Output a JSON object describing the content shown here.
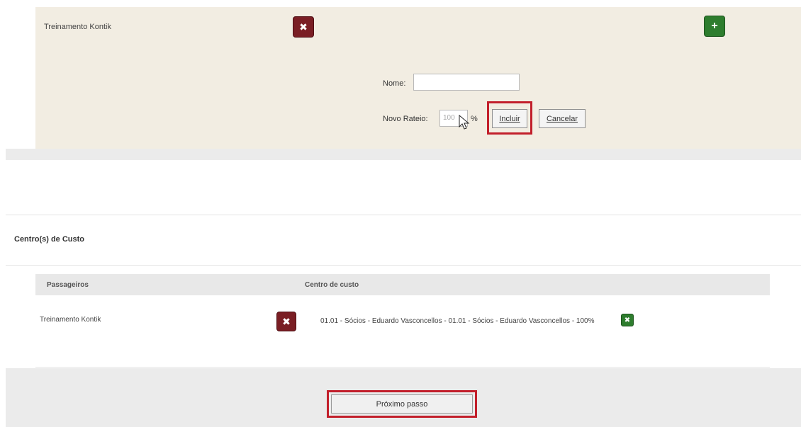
{
  "edit_panel": {
    "passenger_name": "Treinamento Kontik",
    "remove_icon": "close-icon",
    "add_icon": "plus-icon",
    "nome_label": "Nome:",
    "nome_value": "",
    "rateio_label": "Novo Rateio:",
    "rateio_value": "100",
    "percent_sign": "%",
    "incluir_label": "Incluir",
    "cancelar_label": "Cancelar"
  },
  "cost_center_section": {
    "title": "Centro(s) de Custo",
    "columns": [
      "Passageiros",
      "Centro de custo"
    ],
    "rows": [
      {
        "passenger": "Treinamento Kontik",
        "cost_center": "01.01 - Sócios - Eduardo Vasconcellos - 01.01 - Sócios - Eduardo Vasconcellos - 100%"
      }
    ]
  },
  "footer": {
    "next_label": "Próximo passo"
  },
  "colors": {
    "panel_bg": "#f2ede2",
    "remove_btn": "#7a1e24",
    "add_btn": "#2e7d2e",
    "highlight": "#c21f2b"
  }
}
